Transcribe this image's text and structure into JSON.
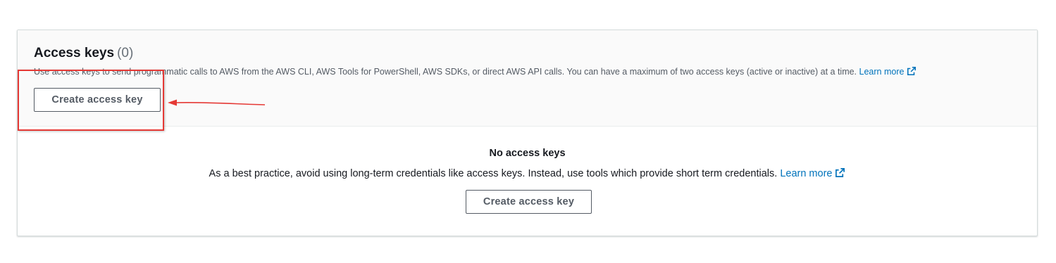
{
  "access_keys": {
    "title": "Access keys",
    "count": "(0)",
    "description": "Use access keys to send programmatic calls to AWS from the AWS CLI, AWS Tools for PowerShell, AWS SDKs, or direct AWS API calls. You can have a maximum of two access keys (active or inactive) at a time.",
    "learn_more": "Learn more",
    "create_button": "Create access key"
  },
  "empty_state": {
    "title": "No access keys",
    "description": "As a best practice, avoid using long-term credentials like access keys. Instead, use tools which provide short term credentials.",
    "learn_more": "Learn more",
    "create_button": "Create access key"
  },
  "icons": {
    "external_link": "external-link-icon"
  },
  "colors": {
    "link": "#0073bb",
    "annotation": "#e53935",
    "header_background": "#fafafa",
    "button_border": "#545b64"
  }
}
